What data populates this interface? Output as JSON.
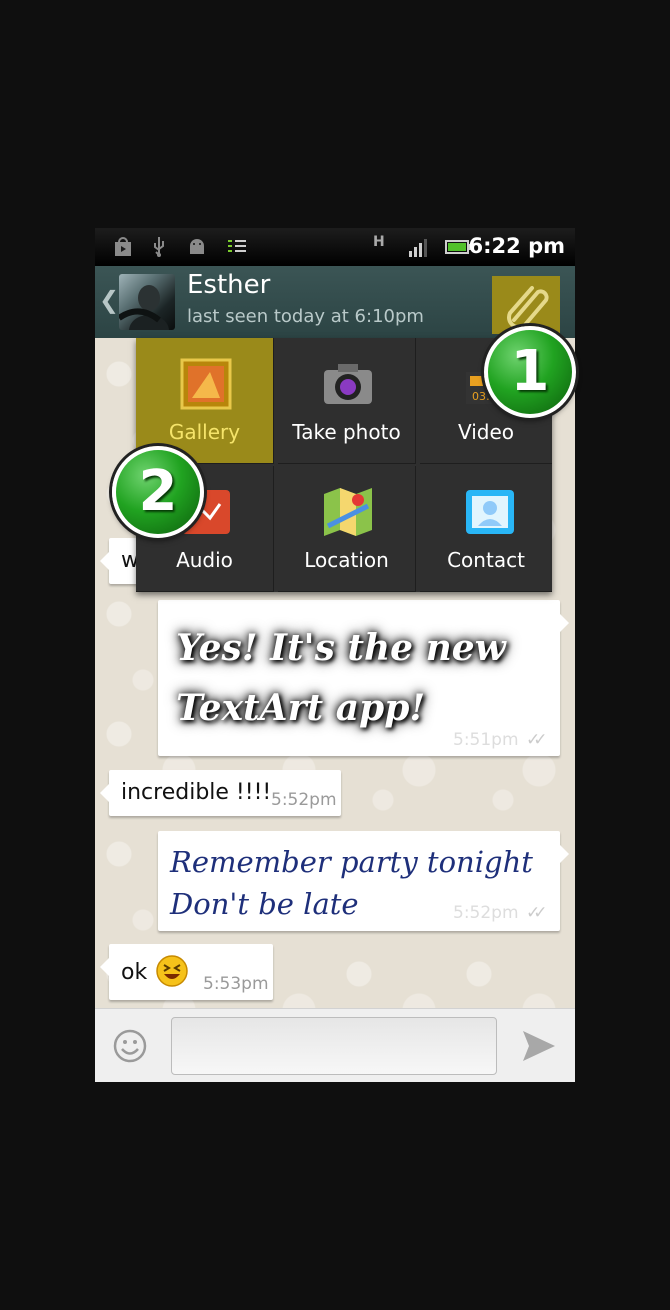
{
  "status_bar": {
    "time": "6:22 pm",
    "network_label": "H",
    "icons": [
      "play-store-icon",
      "usb-icon",
      "android-debug-icon",
      "sync-icon",
      "network-h-icon",
      "signal-icon",
      "battery-icon"
    ]
  },
  "header": {
    "contact_name": "Esther",
    "last_seen": "last seen today at 6:10pm",
    "back_glyph": "❮",
    "attach_icon": "paperclip-icon"
  },
  "attach_menu": {
    "items": [
      {
        "label": "Gallery",
        "icon": "gallery-icon",
        "selected": true
      },
      {
        "label": "Take photo",
        "icon": "camera-icon"
      },
      {
        "label": "Video",
        "icon": "video-icon"
      },
      {
        "label": "Audio",
        "icon": "audio-icon"
      },
      {
        "label": "Location",
        "icon": "map-icon"
      },
      {
        "label": "Contact",
        "icon": "contact-card-icon"
      }
    ]
  },
  "callouts": [
    "1",
    "2"
  ],
  "messages": [
    {
      "direction": "in",
      "text": "w"
    },
    {
      "direction": "out",
      "text": "Yes! It's the new TextArt app!",
      "time": "5:51pm",
      "ticks": "✓✓"
    },
    {
      "direction": "in",
      "text": "incredible !!!!",
      "time": "5:52pm"
    },
    {
      "direction": "out",
      "text": "Remember party tonight Don't be late",
      "time": "5:52pm",
      "ticks": "✓✓"
    },
    {
      "direction": "in",
      "text": "ok",
      "emoji": "laughing-face-icon",
      "time": "5:53pm"
    }
  ],
  "input_bar": {
    "emoji_icon": "smiley-icon",
    "placeholder": "",
    "send_icon": "send-arrow-icon"
  },
  "colors": {
    "header_bg": "#2f4a4a",
    "accent": "#9a8a1a",
    "badge_green": "#21a321"
  }
}
